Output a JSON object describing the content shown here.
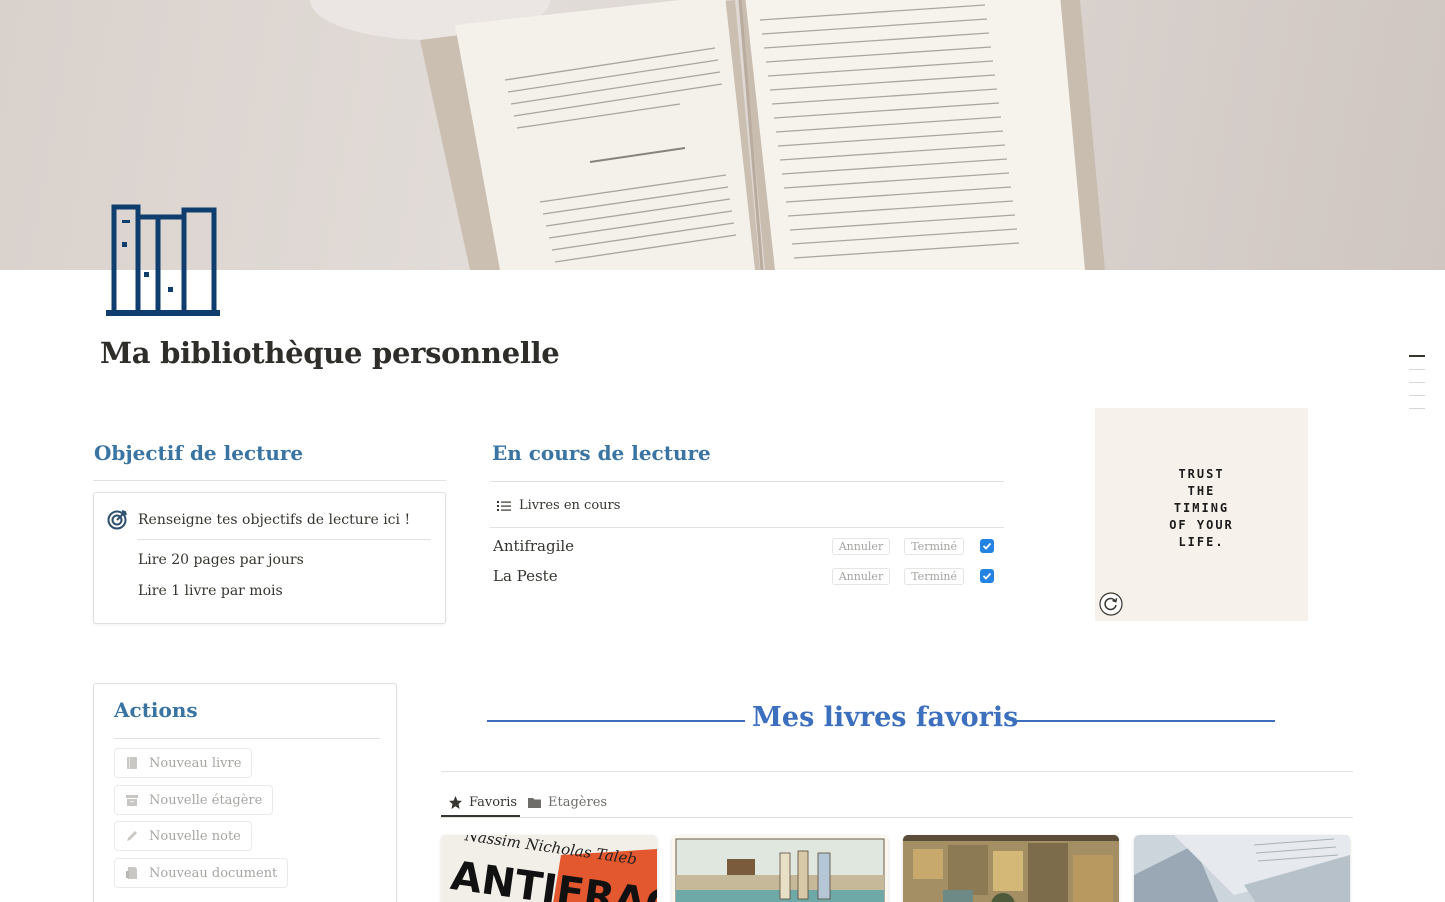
{
  "page": {
    "title": "Ma bibliothèque personnelle"
  },
  "objectif": {
    "heading": "Objectif de lecture",
    "callout": "Renseigne tes objectifs de lecture ici !",
    "items": [
      "Lire 20 pages par jours",
      "Lire 1 livre par mois"
    ]
  },
  "en_cours": {
    "heading": "En cours de lecture",
    "view_label": "Livres en cours",
    "rows": [
      {
        "name": "Antifragile",
        "cancel_label": "Annuler",
        "done_label": "Terminé",
        "checked": true
      },
      {
        "name": "La Peste",
        "cancel_label": "Annuler",
        "done_label": "Terminé",
        "checked": true
      }
    ]
  },
  "quote": {
    "lines": [
      "TRUST",
      "THE",
      "TIMING",
      "OF YOUR",
      "LIFE."
    ]
  },
  "actions": {
    "heading": "Actions",
    "buttons": [
      "Nouveau livre",
      "Nouvelle étagère",
      "Nouvelle note",
      "Nouveau document"
    ]
  },
  "favoris": {
    "heading": "Mes livres favoris",
    "tabs": [
      "Favoris",
      "Etagères"
    ],
    "active_tab": "Favoris",
    "card1_author": "Nassim Nicholas Taleb",
    "card1_title": "ANTIFRAGILE"
  },
  "colors": {
    "heading_blue": "#3a74a2",
    "favoris_blue": "#3d6fbf",
    "icon_navy": "#0f3d6e",
    "checkbox_blue": "#2383e2"
  }
}
